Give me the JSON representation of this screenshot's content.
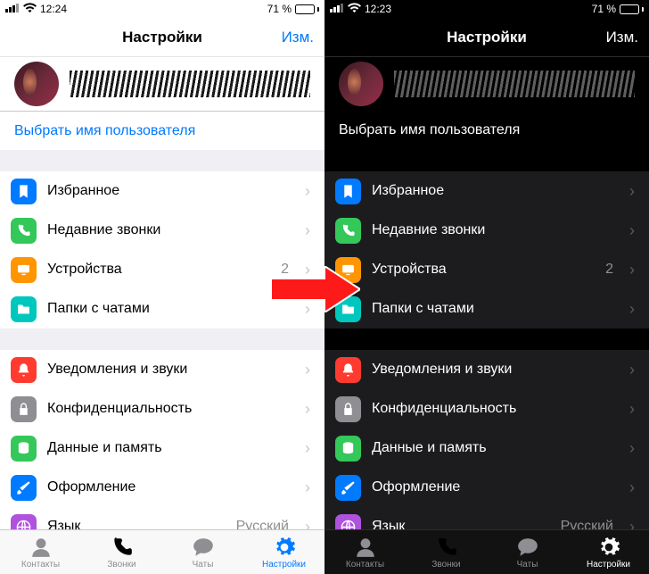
{
  "status": {
    "time_light": "12:24",
    "time_dark": "12:23",
    "battery": "71 %",
    "signal": "ııll",
    "wifi": "wifi"
  },
  "nav": {
    "title": "Настройки",
    "edit": "Изм."
  },
  "username_link": "Выбрать имя пользователя",
  "section1": [
    {
      "key": "saved",
      "label": "Избранное",
      "color": "#007aff",
      "value": ""
    },
    {
      "key": "recent",
      "label": "Недавние звонки",
      "color": "#34c759",
      "value": ""
    },
    {
      "key": "devices",
      "label": "Устройства",
      "color": "#ff9500",
      "value": "2"
    },
    {
      "key": "folders",
      "label": "Папки с чатами",
      "color": "#00c7be",
      "value": ""
    }
  ],
  "section2": [
    {
      "key": "notif",
      "label": "Уведомления и звуки",
      "color": "#ff3b30",
      "value": ""
    },
    {
      "key": "priv",
      "label": "Конфиденциальность",
      "color": "#8e8e93",
      "value": ""
    },
    {
      "key": "data",
      "label": "Данные и память",
      "color": "#34c759",
      "value": ""
    },
    {
      "key": "theme",
      "label": "Оформление",
      "color": "#007aff",
      "value": ""
    },
    {
      "key": "lang",
      "label": "Язык",
      "color": "#af52de",
      "value": "Русский"
    }
  ],
  "tabs": [
    {
      "key": "contacts",
      "label": "Контакты"
    },
    {
      "key": "calls",
      "label": "Звонки"
    },
    {
      "key": "chats",
      "label": "Чаты"
    },
    {
      "key": "settings",
      "label": "Настройки"
    }
  ],
  "icons": {
    "saved": "bookmark",
    "recent": "phone",
    "devices": "monitor",
    "folders": "folder",
    "notif": "bell",
    "priv": "lock",
    "data": "db",
    "theme": "brush",
    "lang": "globe",
    "contacts": "user",
    "calls": "phone",
    "chats": "bubble",
    "settings": "gear"
  }
}
